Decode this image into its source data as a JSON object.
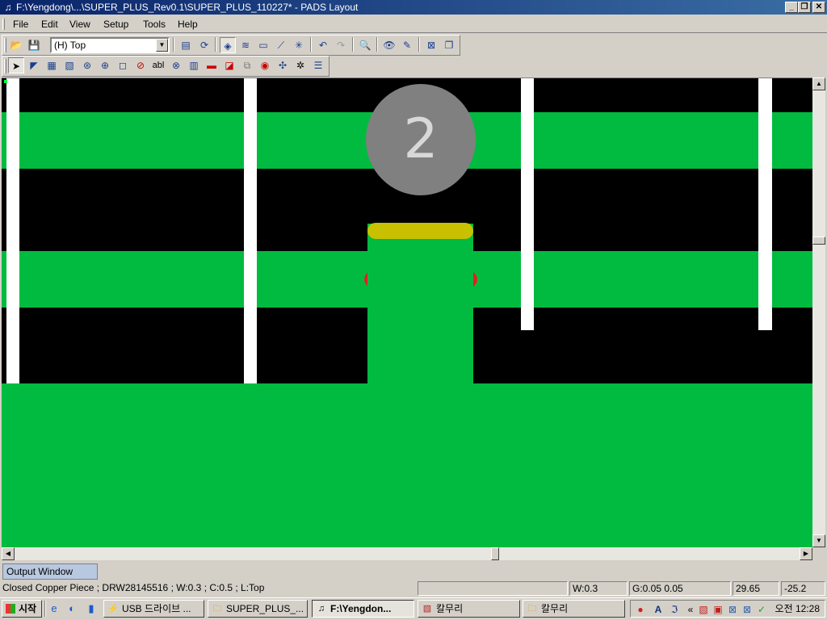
{
  "window": {
    "title": "F:\\Yengdong\\...\\SUPER_PLUS_Rev0.1\\SUPER_PLUS_110227* - PADS Layout",
    "app_icon": "pads-icon",
    "min_label": "_",
    "restore_label": "❐",
    "close_label": "✕"
  },
  "menu": {
    "items": [
      "File",
      "Edit",
      "View",
      "Setup",
      "Tools",
      "Help"
    ]
  },
  "toolbar1": {
    "layer_value": "(H) Top",
    "buttons": [
      "open-icon",
      "save-icon",
      "properties-icon",
      "redraw-icon",
      "display-control-icon",
      "pour-icon",
      "design-toolbar-icon",
      "route-icon",
      "ecoroute-icon",
      "undo-icon",
      "redo-icon",
      "zoom-icon",
      "view-icon",
      "paint-icon",
      "verify-icon",
      "window-icon"
    ],
    "glyphs": [
      "📂",
      "💾",
      "▤",
      "⟳",
      "◈",
      "≋",
      "▭",
      "⟋",
      "✳",
      "↶",
      "↷",
      "🔍",
      "👁",
      "✎",
      "⊠",
      "❐"
    ]
  },
  "toolbar2": {
    "buttons": [
      "select-icon",
      "move-icon",
      "copper-icon",
      "copper-cutout-icon",
      "flood-icon",
      "hatch-icon",
      "board-outline-icon",
      "keepout-icon",
      "text-icon",
      "dimension-icon",
      "component-icon",
      "jumper-icon",
      "drill-icon",
      "auto-dimension-icon",
      "via-icon",
      "network-icon",
      "report-icon"
    ],
    "glyphs": [
      "➤",
      "◤",
      "▦",
      "▧",
      "⊛",
      "⊕",
      "◻",
      "⊘",
      "abl",
      "⊗",
      "▥",
      "▬",
      "◪",
      "⧉",
      "◉",
      "✣",
      "☰"
    ]
  },
  "canvas": {
    "pad_number": "2",
    "colors": {
      "board_bg": "#000000",
      "copper": "#00bb3f",
      "trace": "#ffffff",
      "pad_label_bg": "#808080",
      "silk": "#c8c000",
      "drc": "#e02020"
    }
  },
  "output": {
    "tab_label": "Output Window"
  },
  "status": {
    "message": "Closed Copper Piece ; DRW28145516 ; W:0.3 ; C:0.5 ; L:Top",
    "empty_panel": "",
    "width": "W:0.3",
    "grid": "G:0.05 0.05",
    "x": "29.65",
    "y": "-25.2"
  },
  "taskbar": {
    "start_label": "시작",
    "quick_launch": [
      "ie-icon",
      "outlook-icon",
      "desktop-icon"
    ],
    "quick_glyphs": [
      "e",
      "◐",
      "▮"
    ],
    "tasks": [
      {
        "label": "USB 드라이브 ...",
        "icon": "usb-icon",
        "glyph": "⚡"
      },
      {
        "label": "SUPER_PLUS_...",
        "icon": "folder-icon",
        "glyph": "🗀"
      },
      {
        "label": "F:\\Yengdon...",
        "icon": "pads-icon",
        "glyph": "♫"
      },
      {
        "label": "칼무리",
        "icon": "pdf-icon",
        "glyph": "▧"
      },
      {
        "label": "칼무리",
        "icon": "folder-icon",
        "glyph": "🗀"
      }
    ],
    "tray_glyphs": [
      "●",
      "A",
      "ℑ",
      "«",
      "▧",
      "▣",
      "⊠",
      "⊠",
      "✓"
    ],
    "tray_icons": [
      "ime-flag-icon",
      "ime-mode-icon",
      "ime-input-icon",
      "tray-expand-icon",
      "acrobat-icon",
      "ati-icon",
      "network-icon",
      "network-error-icon",
      "update-icon"
    ],
    "clock": "오전 12:28"
  }
}
